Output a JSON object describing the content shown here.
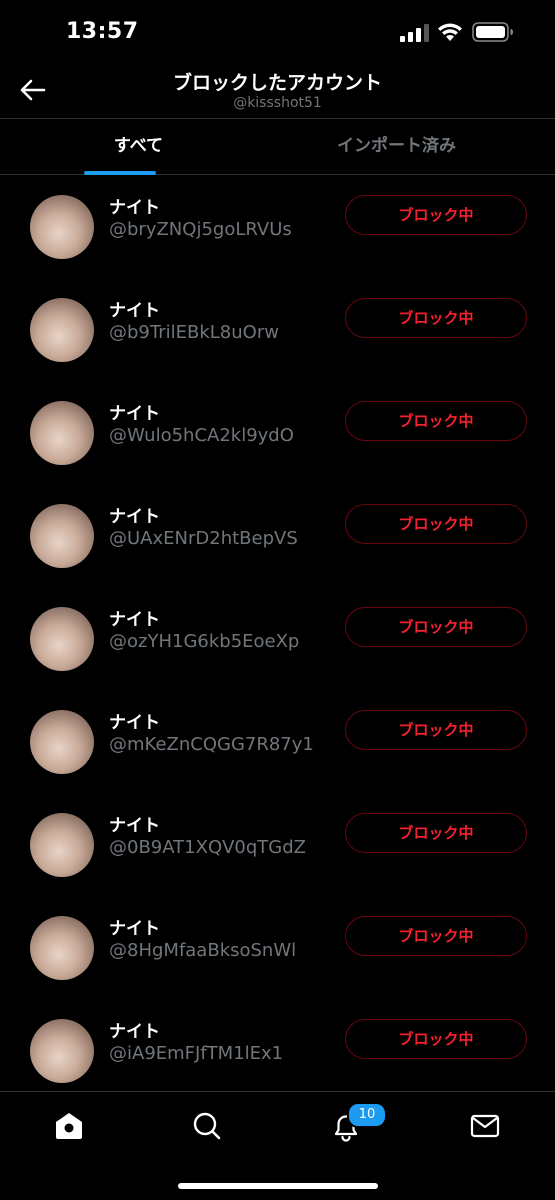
{
  "status_bar": {
    "time": "13:57"
  },
  "header": {
    "title": "ブロックしたアカウント",
    "subtitle": "@kissshot51"
  },
  "tabs": [
    {
      "label": "すべて",
      "active": true
    },
    {
      "label": "インポート済み",
      "active": false
    }
  ],
  "users": [
    {
      "name": "ナイト",
      "handle": "@bryZNQj5goLRVUs",
      "button": "ブロック中"
    },
    {
      "name": "ナイト",
      "handle": "@b9TrilEBkL8uOrw",
      "button": "ブロック中"
    },
    {
      "name": "ナイト",
      "handle": "@Wulo5hCA2kl9ydO",
      "button": "ブロック中"
    },
    {
      "name": "ナイト",
      "handle": "@UAxENrD2htBepVS",
      "button": "ブロック中"
    },
    {
      "name": "ナイト",
      "handle": "@ozYH1G6kb5EoeXp",
      "button": "ブロック中"
    },
    {
      "name": "ナイト",
      "handle": "@mKeZnCQGG7R87y1",
      "button": "ブロック中"
    },
    {
      "name": "ナイト",
      "handle": "@0B9AT1XQV0qTGdZ",
      "button": "ブロック中"
    },
    {
      "name": "ナイト",
      "handle": "@8HgMfaaBksoSnWl",
      "button": "ブロック中"
    },
    {
      "name": "ナイト",
      "handle": "@iA9EmFJfTM1lEx1",
      "button": "ブロック中"
    }
  ],
  "bottom_nav": {
    "items": [
      {
        "icon": "home-icon"
      },
      {
        "icon": "search-icon"
      },
      {
        "icon": "bell-icon"
      },
      {
        "icon": "mail-icon"
      }
    ],
    "notification_count": "10"
  },
  "colors": {
    "accent": "#1d9bf0",
    "block_red": "#f4212e",
    "secondary_text": "#71767b"
  }
}
